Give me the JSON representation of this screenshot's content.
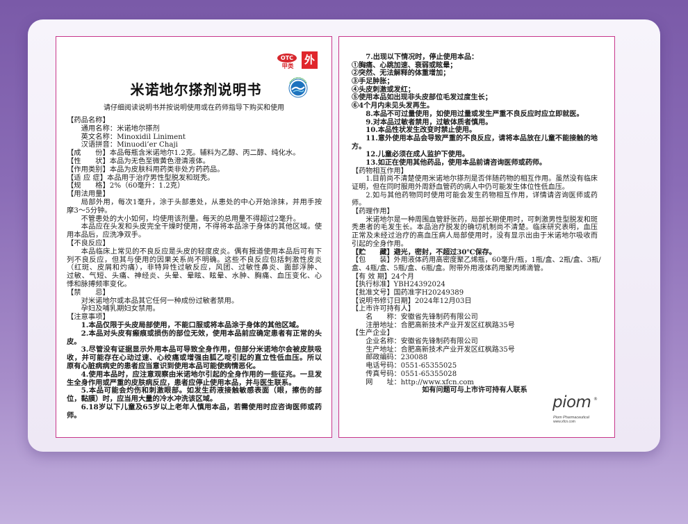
{
  "colors": {
    "background": "#7a5aa8",
    "card": "#f7f4fb",
    "panel_border": "#c7358a",
    "otc_red": "#d7282e",
    "seal_blue": "#1e73be",
    "text": "#1d1d1d"
  },
  "icons": {
    "seal": "quality-seal-icon"
  },
  "leaflet": {
    "badges": {
      "otc": "OTC",
      "otc_class": "甲类",
      "external_use": "外"
    },
    "title": "米诺地尔搽剂说明书",
    "subtitle": "请仔细阅读说明书并按说明使用或在药师指导下购买和使用",
    "left_lines": [
      "【药品名称】",
      "通用名称：米诺地尔搽剂",
      "英文名称：Minoxidil Liniment",
      "汉语拼音：Minuodi’er Chaji",
      "【成　　份】本品每瓶含米诺地尔1.2克。辅料为乙醇、丙二醇、纯化水。",
      "【性　　状】本品为无色至微黄色澄清液体。",
      "【作用类别】本品为皮肤科用药类非处方药药品。",
      "【适 应 症】本品用于治疗男性型脱发和斑秃。",
      "【规　　格】2%（60毫升：1.2克）",
      "【用法用量】",
      "局部外用，每次1毫升，涂于头部患处，从患处的中心开始涂抹，并用手按",
      "摩3～5分钟。",
      "不管患处的大小如何，均使用该剂量。每天的总用量不得超过2毫升。",
      "本品应在头发和头皮完全干燥时使用，不得将本品涂于身体的其他区域。使",
      "用本品后，应洗净双手。",
      "【不良反应】",
      "本品临床上常见的不良反应是头皮的轻度皮炎。偶有报道使用本品后可有下",
      "列不良反应，但其与使用的因果关系尚不明确。这些不良反应包括刺激性皮炎",
      "（红斑、皮屑和灼痛），非特异性过敏反应，风团、过敏性鼻炎、面部浮肿、",
      "过敏、气短、头痛、神经炎、头晕、晕眩、眩晕、水肿、胸痛、血压变化、心",
      "悸和脉搏频率变化。",
      "【禁　　忌】",
      "对米诺地尔或本品其它任何一种成份过敏者禁用。",
      "孕妇及哺乳期妇女禁用。",
      "【注意事项】",
      "1.本品仅限于头皮局部使用，不能口服或将本品涂于身体的其他区域。",
      "2.本品对头皮有瘢痕或损伤的部位无效，使用本品前应确定患者有正常的头",
      "皮。",
      "3.尽管没有证据显示外用本品可导致全身作用，但部分米诺地尔会被皮肤吸",
      "收，并可能存在心动过速、心绞痛或增强由胍乙啶引起的直立性低血压。所以",
      "原有心脏病病史的患者应当意识到使用本品可能使病情恶化。",
      "4.使用本品时，应注意观察由米诺地尔引起的全身作用的一些征兆。一旦发",
      "生全身作用或严重的皮肤病反应，患者应停止使用本品，并与医生联系。",
      "5.本品可能会灼伤和刺激眼部。如发生药液接触敏感表面（眼，擦伤的部",
      "位，黏膜）时，应当用大量的冷水冲洗该区域。",
      "6.18岁以下儿童及65岁以上老年人慎用本品，若需使用时应咨询医师或药",
      "师。"
    ],
    "right_lines": [
      "7.出现以下情况时，停止使用本品：",
      "①胸痛、心跳加速、衰弱或眩晕；",
      "②突然、无法解释的体重增加；",
      "③手足肿胀；",
      "④头皮刺激或发红；",
      "⑤使用本品如出现非头皮部位毛发过度生长；",
      "⑥4个月内未见头发再生。",
      "8.本品不可过量使用，如使用过量或发生严重不良反应时应立即就医。",
      "9.对本品过敏者禁用，过敏体质者慎用。",
      "10.本品性状发生改变时禁止使用。",
      "11.意外使用本品会导致严重的不良反应，请将本品放在儿童不能接触的地",
      "方。",
      "12.儿童必须在成人监护下使用。",
      "13.如正在使用其他药品，使用本品前请咨询医师或药师。",
      "【药物相互作用】",
      "1.目前尚不清楚使用米诺地尔搽剂是否伴随药物的相互作用。虽然没有临床",
      "证明，但在同时服用外周舒血管药的病人中仍可能发生体位性低血压。",
      "2.如与其他药物同时使用可能会发生药物相互作用，详情请咨询医师或药",
      "师。",
      "【药理作用】",
      "米诺地尔是一种周围血管舒张药，局部长期使用时，可刺激男性型脱发和斑",
      "秃患者的毛发生长。本品治疗脱发的确切机制尚不清楚。临床研究表明，血压",
      "正常及未经过治疗的高血压病人局部使用时，没有显示出由于米诺地尔吸收而",
      "引起的全身作用。",
      "【贮　　藏】避光，密封，不超过30℃保存。",
      "【包　　装】外用液体药用高密度聚乙烯瓶，60毫升/瓶，1瓶/盒、2瓶/盒、3瓶/",
      "盒、4瓶/盒、5瓶/盒、6瓶/盒。附带外用液体药用聚丙烯滴管。",
      "【有 效 期】24个月",
      "【执行标准】YBH24392024",
      "【批准文号】国药准字H20249389",
      "【说明书修订日期】2024年12月03日",
      "【上市许可持有人】",
      "名　　称：安徽省先锋制药有限公司",
      "注册地址：合肥高新技术产业开发区红枫路35号",
      "【生产企业】",
      "企业名称：安徽省先锋制药有限公司",
      "生产地址：合肥高新技术产业开发区红枫路35号",
      "邮政编码：230088",
      "电话号码：0551-65355025",
      "传真号码：0551-65355028",
      "网　　址：http://www.xfcn.com",
      "如有问题可与上市许可持有人联系"
    ],
    "brand": {
      "logo": "piom",
      "registered": "®",
      "company": "Piom Pharmaceutical",
      "website": "www.xfcn.com"
    }
  }
}
